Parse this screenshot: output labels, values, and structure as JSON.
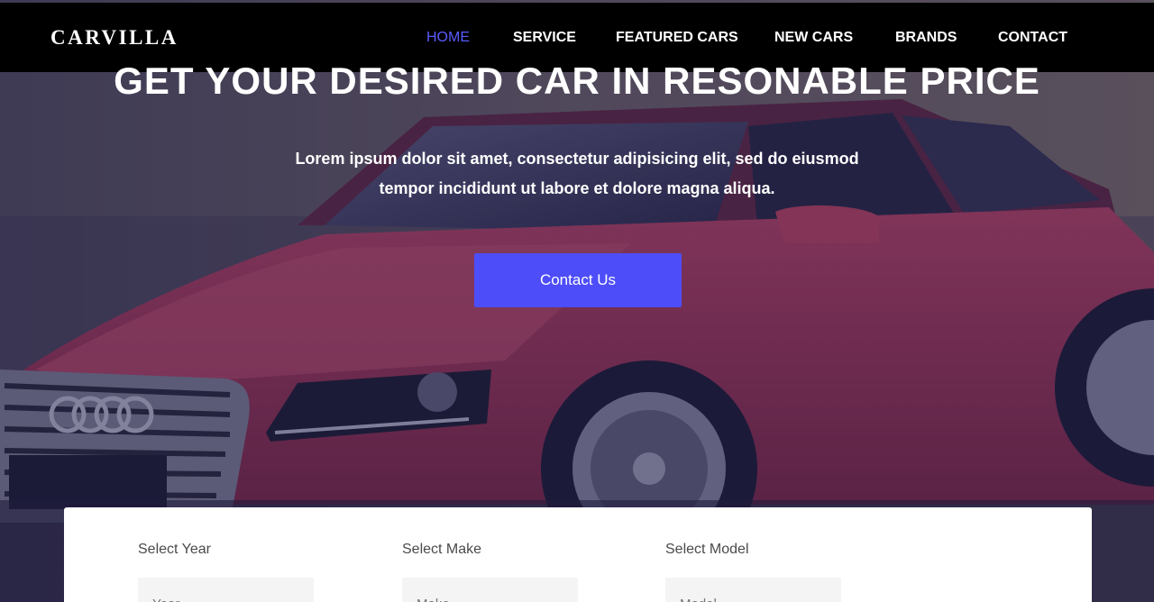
{
  "brand": {
    "logo": "CARVILLA"
  },
  "nav": {
    "items": [
      {
        "label": "HOME",
        "active": true
      },
      {
        "label": "SERVICE",
        "active": false
      },
      {
        "label": "FEATURED CARS",
        "active": false
      },
      {
        "label": "NEW CARS",
        "active": false
      },
      {
        "label": "BRANDS",
        "active": false
      },
      {
        "label": "CONTACT",
        "active": false
      }
    ]
  },
  "hero": {
    "title": "GET YOUR DESIRED CAR IN RESONABLE PRICE",
    "subtitle_line1": "Lorem ipsum dolor sit amet, consectetur adipisicing elit, sed do eiusmod",
    "subtitle_line2": "tempor incididunt ut labore et dolore magna aliqua.",
    "cta_label": "Contact Us"
  },
  "search": {
    "fields": [
      {
        "label": "Select Year",
        "placeholder": "Year"
      },
      {
        "label": "Select Make",
        "placeholder": "Make"
      },
      {
        "label": "Select Model",
        "placeholder": "Model"
      }
    ]
  },
  "colors": {
    "accent": "#4d4dfa",
    "nav_active": "#5a5aff",
    "navbar_bg": "#000000",
    "car": "#b8344f"
  }
}
